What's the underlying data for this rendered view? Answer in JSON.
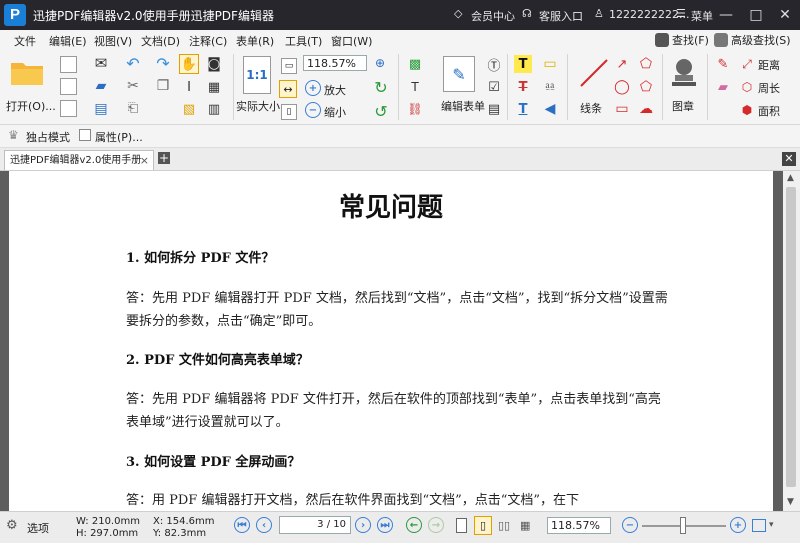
{
  "titlebar": {
    "title": "迅捷PDF编辑器v2.0使用手册迅捷PDF编辑器",
    "logo": "P",
    "member_center": "会员中心",
    "customer_service": "客服入口",
    "user": "1222222222...",
    "menu": "菜单",
    "minimize": "—",
    "maximize": "□",
    "close": "✕"
  },
  "menubar": {
    "items": [
      "文件",
      "编辑(E)",
      "视图(V)",
      "文档(D)",
      "注释(C)",
      "表单(R)",
      "工具(T)",
      "窗口(W)"
    ],
    "find": "查找(F)",
    "advanced_find": "高级查找(S)"
  },
  "toolbar": {
    "open": "打开(O)...",
    "actual_size": "实际大小",
    "zoom": "118.57%",
    "zoom_in": "放大",
    "zoom_out": "缩小",
    "edit_form": "编辑表单",
    "lines": "线条",
    "stamp": "图章",
    "distance": "距离",
    "perimeter": "周长",
    "area": "面积"
  },
  "moderow": {
    "exclusive_mode": "独占模式",
    "properties": "属性(P)..."
  },
  "tabs": {
    "doc_tab": "迅捷PDF编辑器v2.0使用手册",
    "close": "×"
  },
  "document": {
    "title": "常见问题",
    "q1": "1.  如何拆分 PDF 文件？",
    "a1": "答：先用 PDF 编辑器打开 PDF 文档，然后找到“文档”，点击“文档”，找到“拆分文档”设置需要拆分的参数，点击“确定”即可。",
    "q2": "2.  PDF 文件如何高亮表单域？",
    "a2": "答：先用 PDF 编辑器将 PDF 文件打开，然后在软件的顶部找到“表单”，点击表单找到“高亮表单域”进行设置就可以了。",
    "q3": "3.  如何设置 PDF 全屏动画？",
    "a3": "答：用 PDF 编辑器打开文档，然后在软件界面找到“文档”，点击“文档”，在下"
  },
  "statusbar": {
    "options": "选项",
    "width": "W: 210.0mm",
    "height": "H: 297.0mm",
    "x": "X: 154.6mm",
    "y": "Y: 82.3mm",
    "page": "3 / 10",
    "zoom": "118.57%"
  },
  "colors": {
    "titlebar_bg": "#27262c",
    "accent_blue": "#3a7ed6",
    "menu_bg": "#f4f4f4"
  }
}
